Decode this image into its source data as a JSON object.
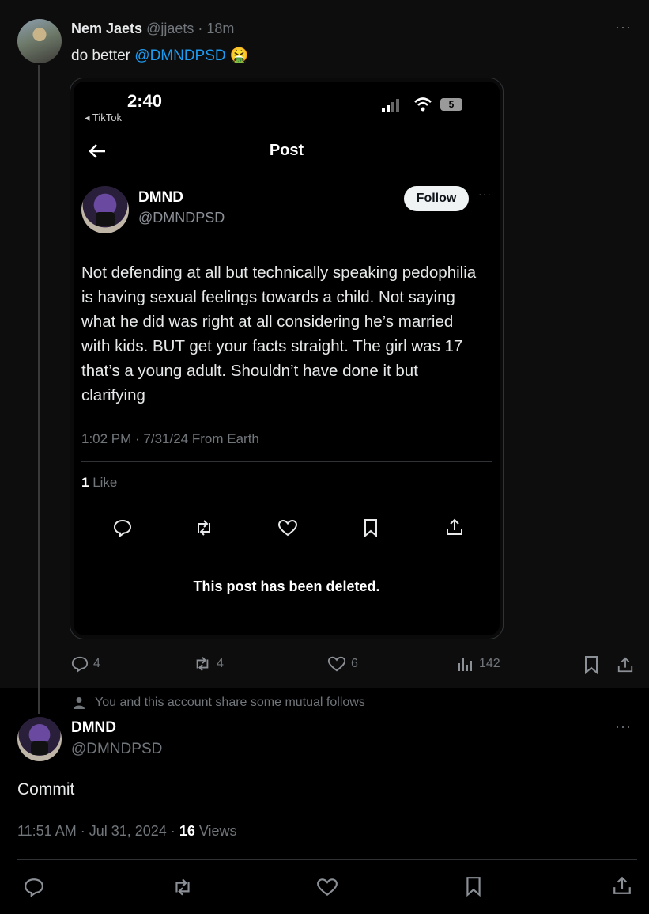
{
  "quote_tweet": {
    "author_name": "Nem Jaets",
    "author_handle": "@jjaets",
    "time_ago": "· 18m",
    "text_prefix": "do better",
    "mention": "@DMNDPSD",
    "emoji": "🤮"
  },
  "screenshot": {
    "status_time": "2:40",
    "back_app": "◂ TikTok",
    "battery": "5",
    "header_title": "Post",
    "author_name": "DMND",
    "author_handle": "@DMNDPSD",
    "follow_label": "Follow",
    "body": "Not defending at all but technically speaking pedophilia is having sexual feelings towards a child. Not saying what he did was right at all considering he’s married with kids. BUT get your facts straight. The girl was 17 that’s a young adult. Shouldn’t have done it but clarifying",
    "meta": "1:02 PM · 7/31/24 From Earth",
    "likes_count": "1",
    "likes_label": "Like",
    "deleted_notice": "This post has been deleted."
  },
  "quote_actions": {
    "replies": "4",
    "reposts": "4",
    "likes": "6",
    "views": "142"
  },
  "social_context": "You and this account share some mutual follows",
  "reply_tweet": {
    "author_name": "DMND",
    "author_handle": "@DMNDPSD",
    "text": "Commit",
    "timestamp": "11:51 AM · Jul 31, 2024 ·",
    "views_count": "16",
    "views_label": "Views"
  }
}
